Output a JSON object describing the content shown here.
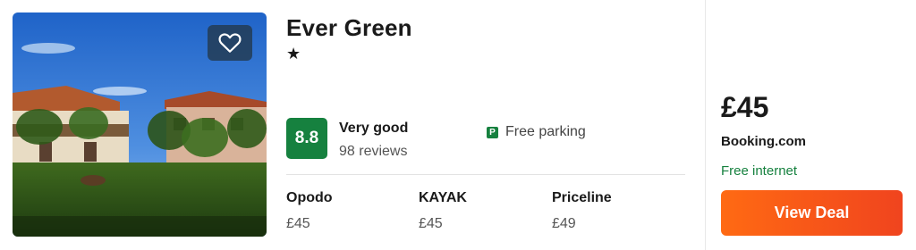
{
  "hotel": {
    "name": "Ever Green",
    "stars": "★",
    "rating": {
      "score": "8.8",
      "label": "Very good",
      "reviews": "98 reviews",
      "badge_color": "#16813f"
    },
    "amenity": {
      "icon": "parking-icon",
      "label": "Free parking"
    }
  },
  "providers": [
    {
      "name": "Opodo",
      "price": "£45"
    },
    {
      "name": "KAYAK",
      "price": "£45"
    },
    {
      "name": "Priceline",
      "price": "£49"
    }
  ],
  "deal": {
    "price": "£45",
    "provider": "Booking.com",
    "perk": "Free internet",
    "button_label": "View Deal",
    "button_color": "#ff5a1a"
  },
  "favorite_icon": "heart-icon",
  "colors": {
    "accent_green": "#16813f",
    "cta_orange": "#ff5a1a",
    "favorite_bg": "#233c55"
  }
}
